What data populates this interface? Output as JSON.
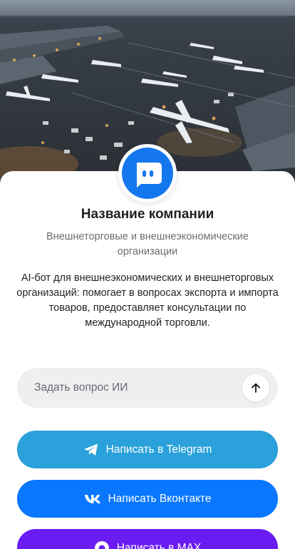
{
  "company": {
    "name": "Название компании",
    "category": "Внешнеторговые и внешнеэкономические организации",
    "description": "AI-бот для внешнеэкономических и внешнеторговых организаций: помогает в вопросах экспорта и импорта товаров, предоставляет консультации по международной торговли."
  },
  "ask": {
    "placeholder": "Задать вопрос ИИ",
    "send_icon": "arrow-up-icon"
  },
  "buttons": {
    "telegram": {
      "label": "Написать в Telegram",
      "icon": "telegram-icon",
      "color": "#2aa1da"
    },
    "vk": {
      "label": "Написать Вконтакте",
      "icon": "vk-icon",
      "color": "#0977ff"
    },
    "max": {
      "label": "Написать в MAX",
      "icon": "max-icon",
      "color": "#6a1cf2"
    }
  },
  "avatar": {
    "icon": "chat-bot-icon",
    "color": "#1477ee"
  },
  "hero": {
    "image": "airport-cargo-aerial-photo"
  }
}
